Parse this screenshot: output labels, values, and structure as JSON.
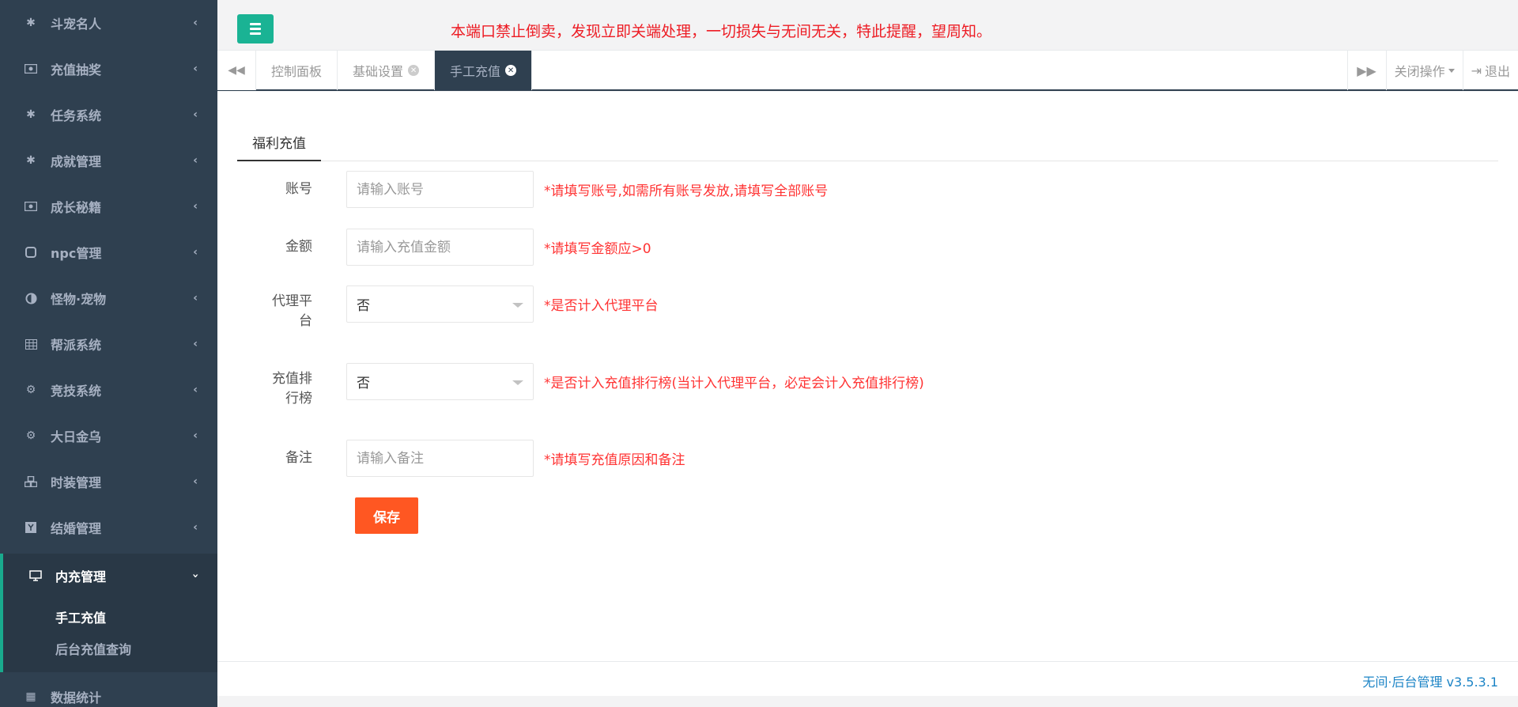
{
  "sidebar": {
    "items": [
      {
        "label": "斗宠名人",
        "icon": "asterisk-icon"
      },
      {
        "label": "充值抽奖",
        "icon": "money-icon"
      },
      {
        "label": "任务系统",
        "icon": "asterisk-icon"
      },
      {
        "label": "成就管理",
        "icon": "asterisk-icon"
      },
      {
        "label": "成长秘籍",
        "icon": "money-icon"
      },
      {
        "label": "npc管理",
        "icon": "square-icon"
      },
      {
        "label": "怪物·宠物",
        "icon": "adjust-icon"
      },
      {
        "label": "帮派系统",
        "icon": "table-icon"
      },
      {
        "label": "竞技系统",
        "icon": "cogs-icon"
      },
      {
        "label": "大日金乌",
        "icon": "cogs-icon"
      },
      {
        "label": "时装管理",
        "icon": "cubes-icon"
      },
      {
        "label": "结婚管理",
        "icon": "yc-icon"
      }
    ],
    "active": {
      "label": "内充管理",
      "icon": "desktop-icon"
    },
    "submenu": [
      "手工充值",
      "后台充值查询"
    ],
    "partial_label": "数据统计"
  },
  "header": {
    "notice": "本端口禁止倒卖，发现立即关端处理，一切损失与无间无关，特此提醒，望周知。"
  },
  "tabbar": {
    "tabs": [
      {
        "label": "控制面板",
        "closable": false
      },
      {
        "label": "基础设置",
        "closable": true
      },
      {
        "label": "手工充值",
        "closable": true,
        "active": true
      }
    ],
    "close_ops": "关闭操作",
    "logout": "退出"
  },
  "panel": {
    "tab": "福利充值"
  },
  "form": {
    "account": {
      "label": "账号",
      "placeholder": "请输入账号",
      "hint": "*请填写账号,如需所有账号发放,请填写全部账号"
    },
    "amount": {
      "label": "金额",
      "placeholder": "请输入充值金额",
      "hint": "*请填写金额应>0"
    },
    "agent": {
      "label_1": "代理平",
      "label_2": "台",
      "value": "否",
      "hint": "*是否计入代理平台"
    },
    "rank": {
      "label_1": "充值排",
      "label_2": "行榜",
      "value": "否",
      "hint": "*是否计入充值排行榜(当计入代理平台，必定会计入充值排行榜)"
    },
    "remark": {
      "label": "备注",
      "placeholder": "请输入备注",
      "hint": "*请填写充值原因和备注"
    },
    "save": "保存"
  },
  "footer": {
    "text": "无间·后台管理 v3.5.3.1"
  },
  "colors": {
    "sidebar_bg": "#2f4050",
    "accent": "#1ab394",
    "save": "#ff5722",
    "hint": "#ff3333",
    "notice": "#ed1c24"
  }
}
